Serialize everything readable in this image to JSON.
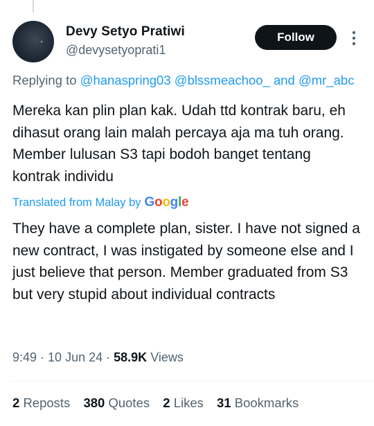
{
  "tweet": {
    "author_name": "Devy Setyo Pratiwi",
    "author_handle": "@devysetyoprati1",
    "follow_label": "Follow",
    "replying_to_label": "Replying to",
    "mentions": [
      "@hanaspring03",
      "@blssmeachoo_",
      "and",
      "@mr_abc"
    ],
    "original_text": "Mereka kan plin plan kak. Udah ttd kontrak baru, eh dihasut orang lain malah percaya aja ma tuh orang. Member lulusan S3 tapi bodoh banget tentang kontrak individu",
    "translated_from_label": "Translated from Malay by",
    "google_logo_text": "Google",
    "translation_text": "They have a complete plan, sister. I have not signed a new contract, I was instigated by someone else and I just believe that person. Member graduated from S3 but very stupid about individual contracts",
    "time": "9:49",
    "date": "10 Jun 24",
    "views_count": "58.9K",
    "views_label": "Views"
  },
  "stats": {
    "reposts_count": "2",
    "reposts_label": "Reposts",
    "quotes_count": "380",
    "quotes_label": "Quotes",
    "likes_count": "2",
    "likes_label": "Likes",
    "bookmarks_count": "31",
    "bookmarks_label": "Bookmarks"
  },
  "colors": {
    "link": "#1d9bf0",
    "secondary_text": "#536471",
    "primary_text": "#0f1419",
    "follow_button_bg": "#0f1419",
    "google_blue": "#4285F4",
    "google_red": "#EA4335",
    "google_yellow": "#FBBC05",
    "google_green": "#34A853"
  },
  "icons": {
    "more_options": "more-vertical-icon"
  }
}
